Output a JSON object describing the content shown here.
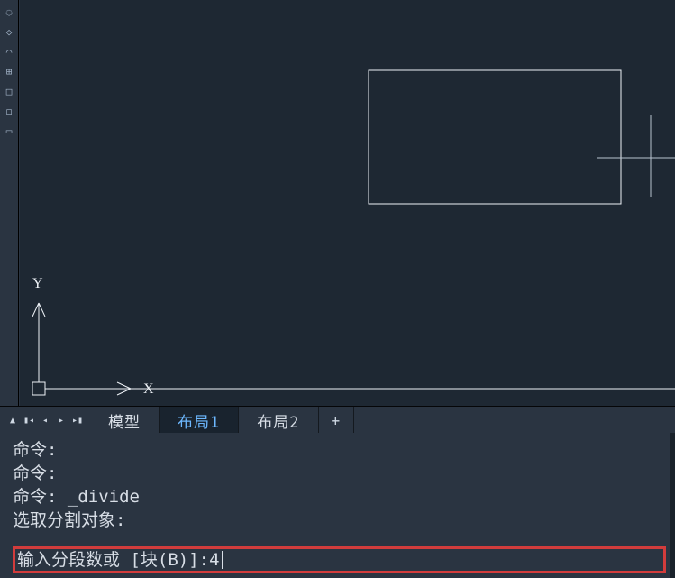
{
  "tabs": {
    "model": "模型",
    "layout1": "布局1",
    "layout2": "布局2",
    "add": "+"
  },
  "axis": {
    "y_label": "Y",
    "x_label": "X"
  },
  "console": {
    "line1": "命令:",
    "line2": "命令:",
    "line3": "命令: _divide",
    "line4": "选取分割对象:"
  },
  "command_input": {
    "prompt": "输入分段数或 [块(B)]: ",
    "value": "4"
  }
}
